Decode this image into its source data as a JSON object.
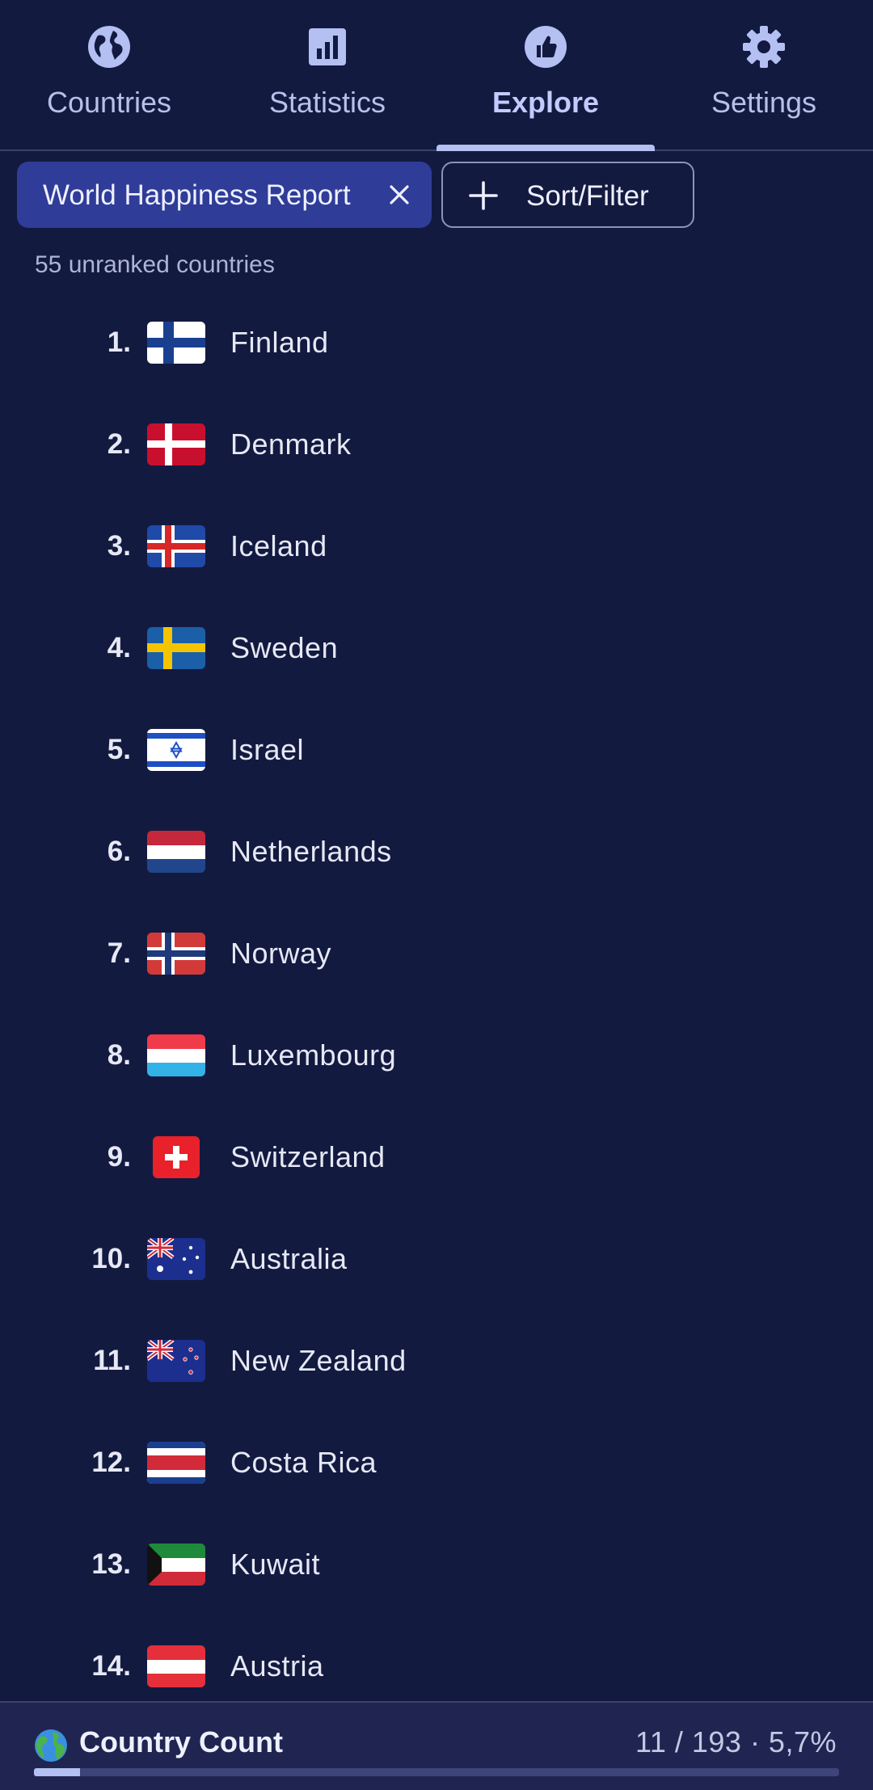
{
  "tabs": [
    {
      "label": "Countries",
      "icon": "globe-icon",
      "active": false
    },
    {
      "label": "Statistics",
      "icon": "bar-chart-icon",
      "active": false
    },
    {
      "label": "Explore",
      "icon": "thumbs-up-icon",
      "active": true
    },
    {
      "label": "Settings",
      "icon": "gear-icon",
      "active": false
    }
  ],
  "filters": {
    "active_filter_label": "World Happiness Report",
    "sort_filter_label": "Sort/Filter"
  },
  "unranked_text": "55 unranked countries",
  "countries": [
    {
      "rank": "1.",
      "name": "Finland",
      "flag": "finland-flag"
    },
    {
      "rank": "2.",
      "name": "Denmark",
      "flag": "denmark-flag"
    },
    {
      "rank": "3.",
      "name": "Iceland",
      "flag": "iceland-flag"
    },
    {
      "rank": "4.",
      "name": "Sweden",
      "flag": "sweden-flag"
    },
    {
      "rank": "5.",
      "name": "Israel",
      "flag": "israel-flag"
    },
    {
      "rank": "6.",
      "name": "Netherlands",
      "flag": "netherlands-flag"
    },
    {
      "rank": "7.",
      "name": "Norway",
      "flag": "norway-flag"
    },
    {
      "rank": "8.",
      "name": "Luxembourg",
      "flag": "luxembourg-flag"
    },
    {
      "rank": "9.",
      "name": "Switzerland",
      "flag": "switzerland-flag"
    },
    {
      "rank": "10.",
      "name": "Australia",
      "flag": "australia-flag"
    },
    {
      "rank": "11.",
      "name": "New Zealand",
      "flag": "new-zealand-flag"
    },
    {
      "rank": "12.",
      "name": "Costa Rica",
      "flag": "costa-rica-flag"
    },
    {
      "rank": "13.",
      "name": "Kuwait",
      "flag": "kuwait-flag"
    },
    {
      "rank": "14.",
      "name": "Austria",
      "flag": "austria-flag"
    }
  ],
  "country_count": {
    "title": "Country Count",
    "value": "11 / 193 · 5,7%",
    "progress": 0.057
  },
  "colors": {
    "background": "#131a40",
    "accent": "#b4bff2",
    "chip_fill": "#2f3c98"
  }
}
